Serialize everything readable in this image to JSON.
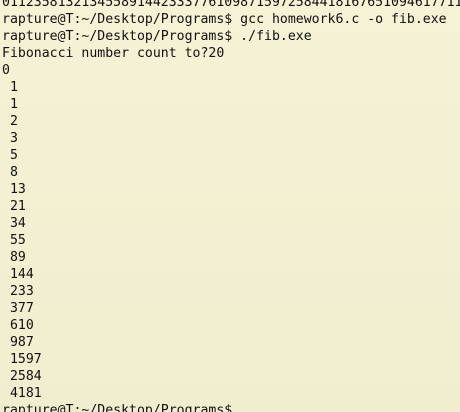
{
  "terminal": {
    "lines": [
      "0112358132134558914423337761098715972584418167651094617711",
      "rapture@T:~/Desktop/Programs$ gcc homework6.c -o fib.exe",
      "rapture@T:~/Desktop/Programs$ ./fib.exe",
      "Fibonacci number count to?20",
      "0",
      " 1",
      " 1",
      " 2",
      " 3",
      " 5",
      " 8",
      " 13",
      " 21",
      " 34",
      " 55",
      " 89",
      " 144",
      " 233",
      " 377",
      " 610",
      " 987",
      " 1597",
      " 2584",
      " 4181",
      "rapture@T:~/Desktop/Programs$"
    ]
  }
}
